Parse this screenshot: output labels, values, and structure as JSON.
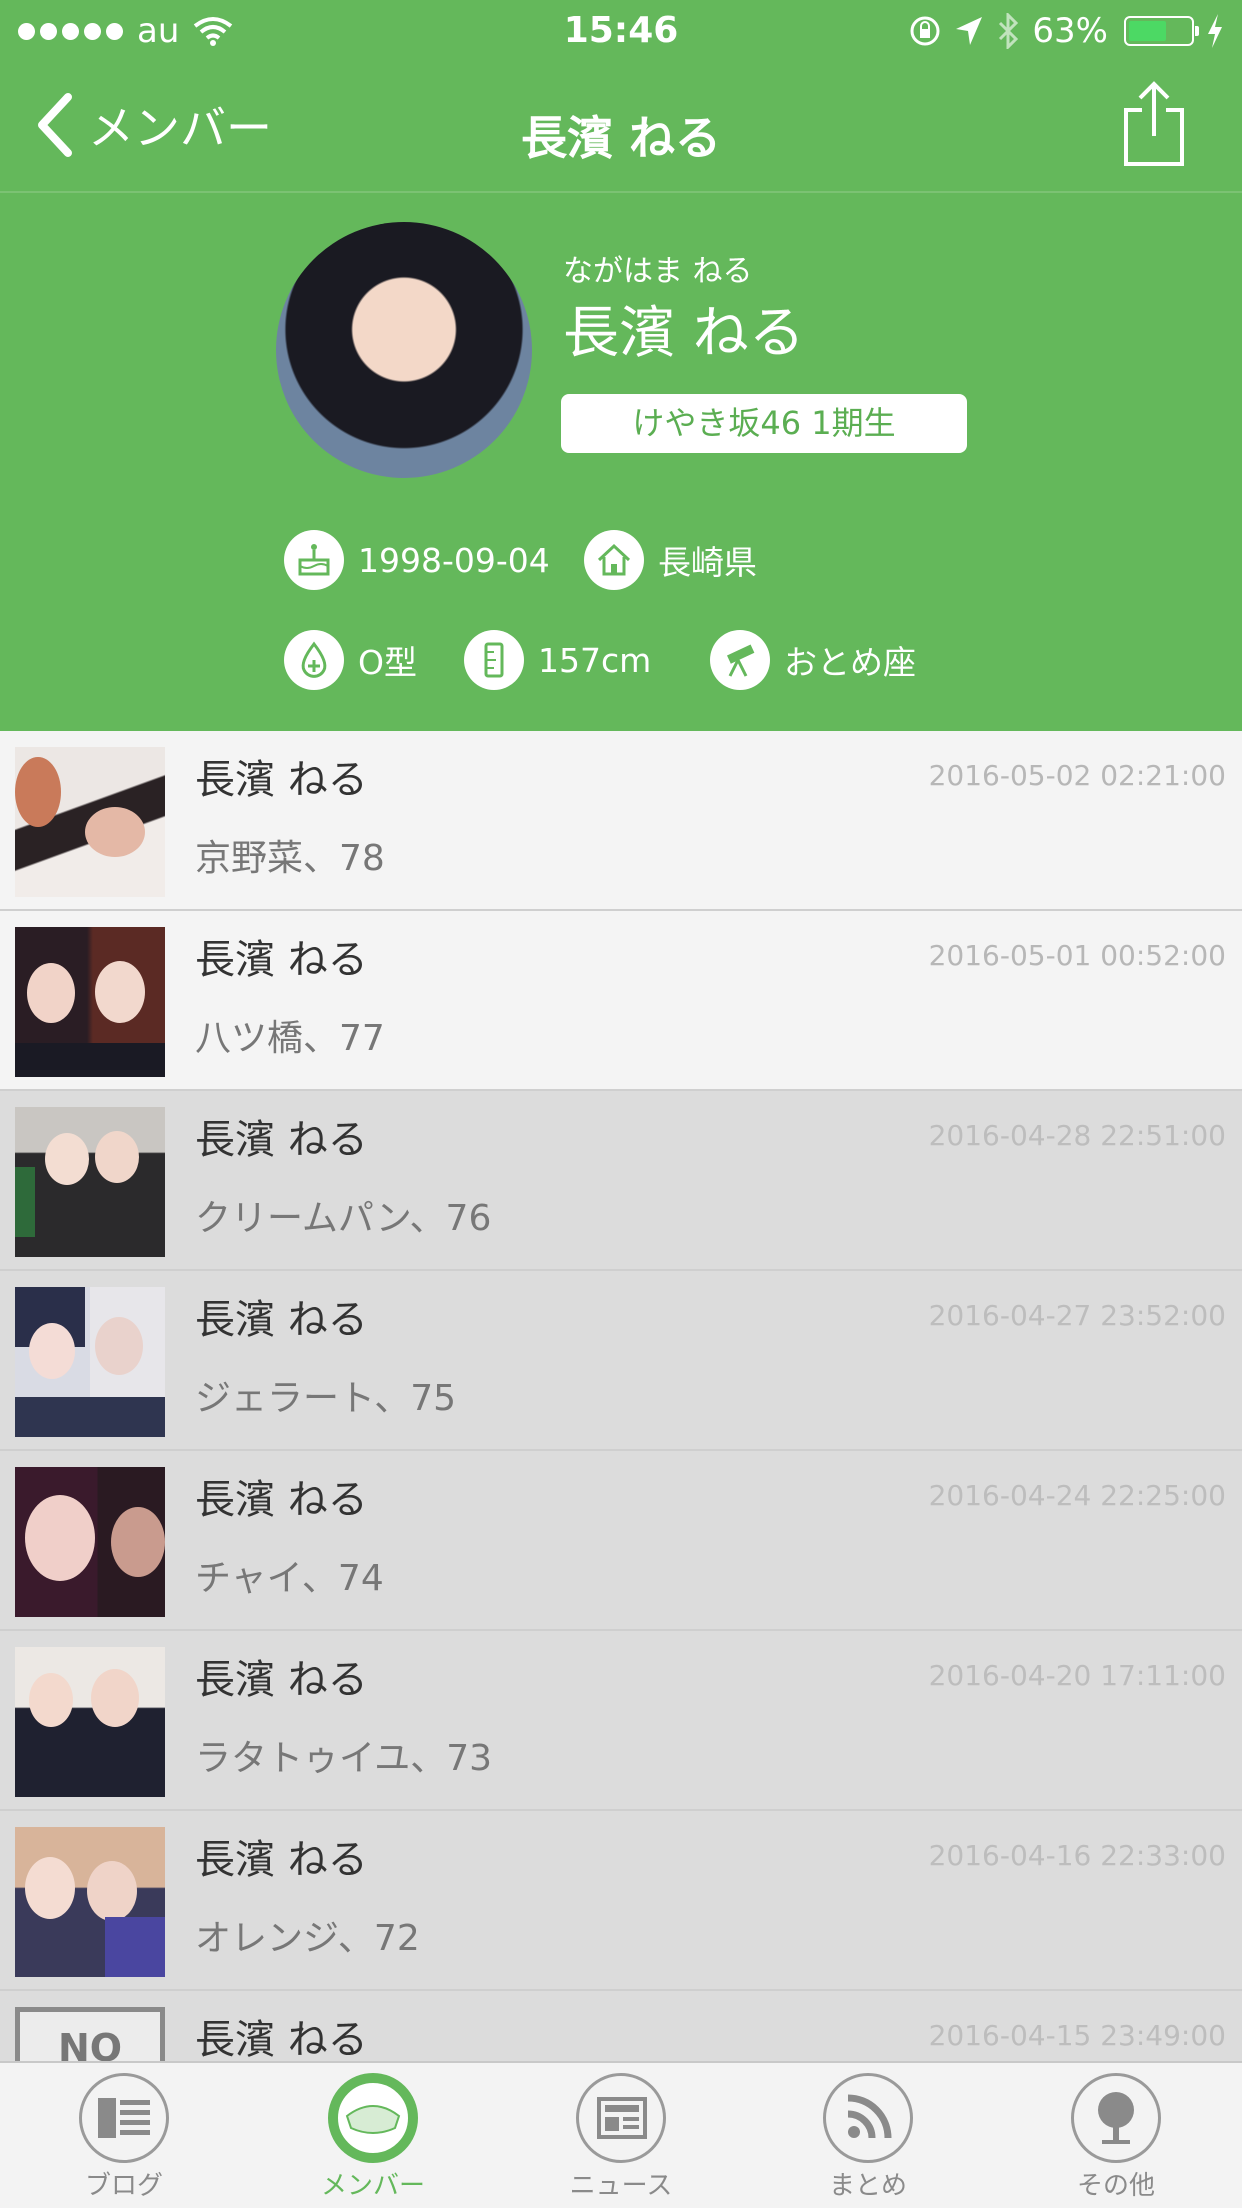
{
  "status_bar": {
    "carrier": "au",
    "time": "15:46",
    "battery": "63%",
    "battery_level": 0.63
  },
  "navbar": {
    "back_label": "メンバー",
    "title": "長濱 ねる"
  },
  "profile": {
    "kana": "ながはま ねる",
    "name": "長濱 ねる",
    "group_badge": "けやき坂46 1期生",
    "birthday": "1998-09-04",
    "hometown": "長崎県",
    "blood_type": "O型",
    "height": "157cm",
    "zodiac": "おとめ座"
  },
  "posts": [
    {
      "author": "長濱 ねる",
      "date": "2016-05-02 02:21:00",
      "title": "京野菜、78"
    },
    {
      "author": "長濱 ねる",
      "date": "2016-05-01 00:52:00",
      "title": "八ツ橋、77"
    },
    {
      "author": "長濱 ねる",
      "date": "2016-04-28 22:51:00",
      "title": "クリームパン、76"
    },
    {
      "author": "長濱 ねる",
      "date": "2016-04-27 23:52:00",
      "title": "ジェラート、75"
    },
    {
      "author": "長濱 ねる",
      "date": "2016-04-24 22:25:00",
      "title": "チャイ、74"
    },
    {
      "author": "長濱 ねる",
      "date": "2016-04-20 17:11:00",
      "title": "ラタトゥイユ、73"
    },
    {
      "author": "長濱 ねる",
      "date": "2016-04-16 22:33:00",
      "title": "オレンジ、72"
    },
    {
      "author": "長濱 ねる",
      "date": "2016-04-15 23:49:00",
      "title": "",
      "thumb_text": "NO"
    }
  ],
  "tabs": [
    {
      "label": "ブログ",
      "icon": "blog-icon"
    },
    {
      "label": "メンバー",
      "icon": "member-icon",
      "active": true
    },
    {
      "label": "ニュース",
      "icon": "news-icon"
    },
    {
      "label": "まとめ",
      "icon": "rss-icon"
    },
    {
      "label": "その他",
      "icon": "tree-icon"
    }
  ],
  "colors": {
    "brand_green": "#64b85b",
    "badge_text": "#5bae52",
    "row_light": "#f4f4f4",
    "row_dark": "#dcdcdc"
  }
}
